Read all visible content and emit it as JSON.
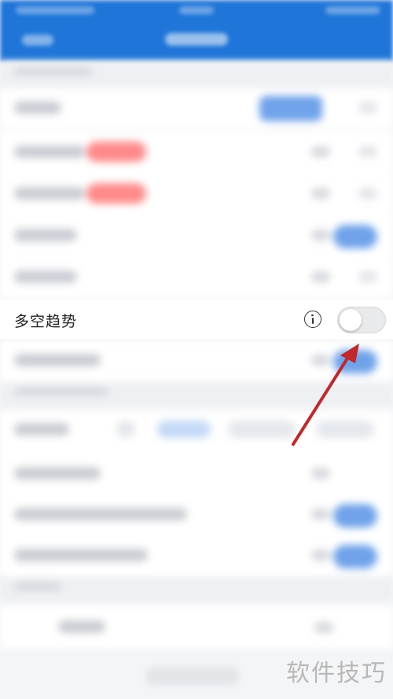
{
  "setting_row": {
    "label": "多空趋势",
    "info_icon": "info-circle-icon",
    "toggle_state": "off"
  },
  "annotation": {
    "arrow_color": "#c0292a",
    "arrow_icon": "pointer-arrow-icon"
  },
  "watermark": {
    "text": "软件技巧"
  },
  "colors": {
    "header": "#1f75d8",
    "accent_blue": "#6fa2ea",
    "badge_red": "#ff8a8a"
  }
}
